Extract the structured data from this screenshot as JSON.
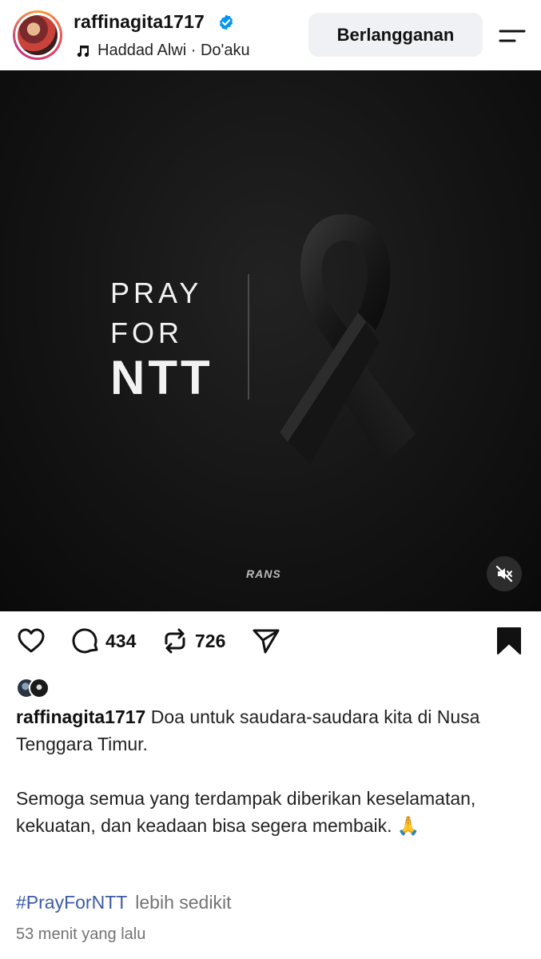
{
  "header": {
    "username": "raffinagita1717",
    "music": "Haddad Alwi · Do'aku",
    "subscribe_label": "Berlangganan",
    "icons": [
      "verified-icon",
      "music-note-icon",
      "menu-icon"
    ]
  },
  "media": {
    "line1": "PRAY",
    "line2": "FOR",
    "line3": "NTT",
    "brand": "RANS",
    "icons": [
      "mute-icon"
    ]
  },
  "actions": {
    "comment_count": "434",
    "repost_count": "726",
    "icons": [
      "heart-icon",
      "comment-icon",
      "repost-icon",
      "send-icon",
      "bookmark-icon"
    ]
  },
  "caption": {
    "username": "raffinagita1717",
    "paragraph1": " Doa untuk saudara-saudara kita di Nusa Tenggara Timur.",
    "paragraph2": "Semoga semua yang terdampak diberikan keselamatan, kekuatan,  dan keadaan bisa segera membaik. 🙏",
    "hashtag": "#PrayForNTT",
    "more": "lebih sedikit"
  },
  "timestamp": "53 menit yang lalu",
  "colors": {
    "hashtag": "#3b5ba8",
    "verified": "#0095f6",
    "button_bg": "#eff1f4"
  }
}
